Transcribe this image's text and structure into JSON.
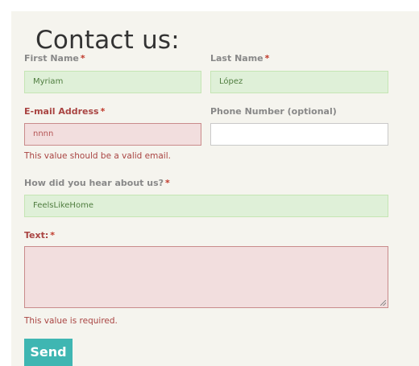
{
  "form": {
    "title": "Contact us:",
    "required_marker": "*",
    "first_name": {
      "label": "First Name",
      "value": "Myriam"
    },
    "last_name": {
      "label": "Last Name",
      "value": "López"
    },
    "email": {
      "label": "E-mail Address",
      "value": "nnnn",
      "error": "This value should be a valid email."
    },
    "phone": {
      "label": "Phone Number (optional)",
      "value": ""
    },
    "source": {
      "label": "How did you hear about us?",
      "value": "FeelsLikeHome"
    },
    "text": {
      "label": "Text:",
      "value": "",
      "error": "This value is required."
    },
    "send_label": "Send"
  },
  "colors": {
    "panel_background": "#f5f4ee",
    "valid_field_background": "#dff0d8",
    "error_field_background": "#f2dede",
    "error_text": "#a94442",
    "button": "#3fb6b2"
  }
}
